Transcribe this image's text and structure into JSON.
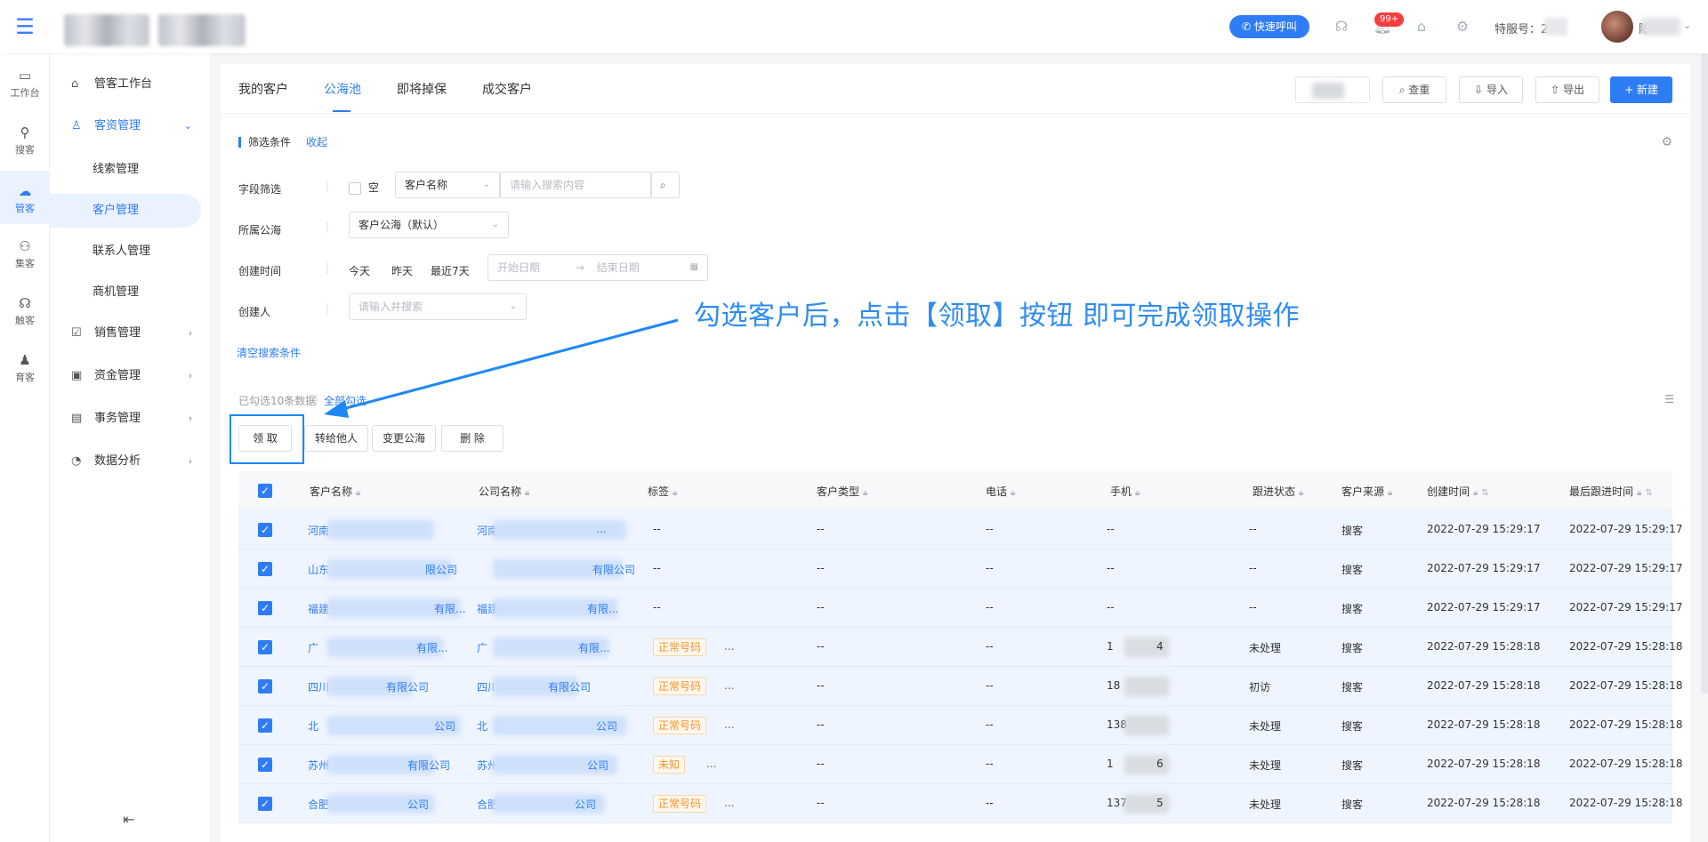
{
  "topbar": {
    "quick_call": "快速呼叫",
    "badge": "99+",
    "seat_label": "特服号：2",
    "user_name": "陈"
  },
  "rail": [
    {
      "label": "工作台",
      "icon": "desktop-icon"
    },
    {
      "label": "搜客",
      "icon": "search-user-icon"
    },
    {
      "label": "管客",
      "icon": "crm-cloud-icon"
    },
    {
      "label": "集客",
      "icon": "group-icon"
    },
    {
      "label": "触客",
      "icon": "headset-icon"
    },
    {
      "label": "育客",
      "icon": "user-grow-icon"
    }
  ],
  "sidebar": {
    "workbench": "管客工作台",
    "customer_mgmt": "客资管理",
    "subs": [
      "线索管理",
      "客户管理",
      "联系人管理",
      "商机管理"
    ],
    "sales": "销售管理",
    "funds": "资金管理",
    "affairs": "事务管理",
    "analysis": "数据分析"
  },
  "tabs": [
    "我的客户",
    "公海池",
    "即将掉保",
    "成交客户"
  ],
  "toolbar": {
    "check_dup": "查重",
    "import": "导入",
    "export": "导出",
    "new": "+ 新建"
  },
  "filters": {
    "title": "筛选条件",
    "collapse": "收起",
    "field_label": "字段筛选",
    "empty_label": "空",
    "field_select": "客户名称",
    "search_placeholder": "请输入搜索内容",
    "pool_label": "所属公海",
    "pool_value": "客户公海（默认）",
    "created_label": "创建时间",
    "quick_today": "今天",
    "quick_yesterday": "昨天",
    "quick_7days": "最近7天",
    "start_date": "开始日期",
    "end_date": "结束日期",
    "creator_label": "创建人",
    "creator_placeholder": "请输入并搜索",
    "clear": "清空搜索条件"
  },
  "annotation": "勾选客户后，点击【领取】按钮 即可完成领取操作",
  "selection": {
    "info": "已勾选10条数据",
    "all": "全部勾选"
  },
  "actions": {
    "claim": "领 取",
    "transfer": "转给他人",
    "change_pool": "变更公海",
    "delete": "删 除"
  },
  "table": {
    "columns": [
      "客户名称",
      "公司名称",
      "标签",
      "客户类型",
      "电话",
      "手机",
      "跟进状态",
      "客户来源",
      "创建时间",
      "最后跟进时间"
    ],
    "rows": [
      {
        "name": "河南",
        "company": "河南",
        "company_tail": "...",
        "tag": "",
        "type": "--",
        "phone": "--",
        "mobile": "--",
        "mobile_tail": "",
        "status": "--",
        "source": "搜客",
        "created": "2022-07-29 15:29:17",
        "last": "2022-07-29 15:29:17",
        "name_tail": ""
      },
      {
        "name": "山东",
        "name_tail": "限公司",
        "company": "",
        "company_tail": "有限公司",
        "tag": "",
        "type": "--",
        "phone": "--",
        "mobile": "--",
        "mobile_tail": "",
        "status": "--",
        "source": "搜客",
        "created": "2022-07-29 15:29:17",
        "last": "2022-07-29 15:29:17"
      },
      {
        "name": "福建",
        "name_tail": "有限...",
        "company": "福建",
        "company_tail": "有限...",
        "tag": "",
        "type": "--",
        "phone": "--",
        "mobile": "--",
        "mobile_tail": "",
        "status": "--",
        "source": "搜客",
        "created": "2022-07-29 15:29:17",
        "last": "2022-07-29 15:29:17"
      },
      {
        "name": "广",
        "name_tail": "有限...",
        "company": "广",
        "company_tail": "有限...",
        "tag": "正常号码",
        "type": "--",
        "phone": "--",
        "mobile": "1",
        "mobile_tail": "4",
        "status": "未处理",
        "source": "搜客",
        "created": "2022-07-29 15:28:18",
        "last": "2022-07-29 15:28:18"
      },
      {
        "name": "四川",
        "name_tail": "有限公司",
        "company": "四川",
        "company_tail": "有限公司",
        "tag": "正常号码",
        "type": "--",
        "phone": "--",
        "mobile": "18",
        "mobile_tail": "",
        "status": "初访",
        "source": "搜客",
        "created": "2022-07-29 15:28:18",
        "last": "2022-07-29 15:28:18"
      },
      {
        "name": "北",
        "name_tail": "公司",
        "company": "北",
        "company_tail": "公司",
        "tag": "正常号码",
        "type": "--",
        "phone": "--",
        "mobile": "138",
        "mobile_tail": "",
        "status": "未处理",
        "source": "搜客",
        "created": "2022-07-29 15:28:18",
        "last": "2022-07-29 15:28:18"
      },
      {
        "name": "苏州",
        "name_tail": "有限公司",
        "company": "苏州",
        "company_tail": "公司",
        "tag": "未知",
        "type": "--",
        "phone": "--",
        "mobile": "1",
        "mobile_tail": "6",
        "status": "未处理",
        "source": "搜客",
        "created": "2022-07-29 15:28:18",
        "last": "2022-07-29 15:28:18"
      },
      {
        "name": "合肥",
        "name_tail": "公司",
        "company": "合肥",
        "company_tail": "公司",
        "tag": "正常号码",
        "type": "--",
        "phone": "--",
        "mobile": "137",
        "mobile_tail": "5",
        "status": "未处理",
        "source": "搜客",
        "created": "2022-07-29 15:28:18",
        "last": "2022-07-29 15:28:18"
      }
    ]
  },
  "colors": {
    "accent": "#2f7df6",
    "annotation": "#2f8cf0",
    "tag_orange": "#f0962e",
    "row_selected": "#eef5ff"
  }
}
